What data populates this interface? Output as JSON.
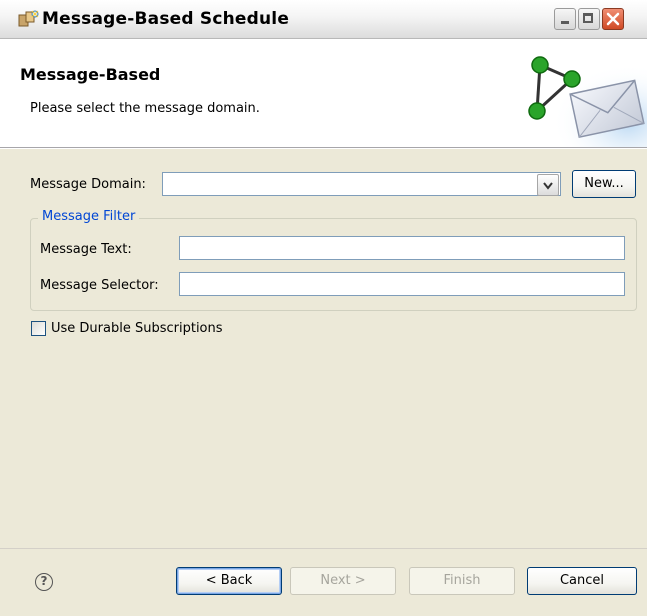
{
  "window": {
    "title": "Message-Based Schedule"
  },
  "header": {
    "title": "Message-Based",
    "description": "Please select the message domain."
  },
  "form": {
    "domain_label": "Message Domain:",
    "domain_value": "",
    "new_button": "New...",
    "filter_group_label": "Message Filter",
    "text_label": "Message Text:",
    "text_value": "",
    "selector_label": "Message Selector:",
    "selector_value": "",
    "durable_label": "Use Durable Subscriptions",
    "durable_checked": false
  },
  "footer": {
    "help_icon": "?",
    "back_button": "< Back",
    "next_button": "Next >",
    "finish_button": "Finish",
    "cancel_button": "Cancel"
  },
  "colors": {
    "dialog_bg": "#ece9d8",
    "group_label": "#0046d5",
    "close_button": "#d04a25"
  },
  "icons": {
    "title": "wizard-puzzle-icon",
    "header": "message-envelope-network-icon"
  }
}
